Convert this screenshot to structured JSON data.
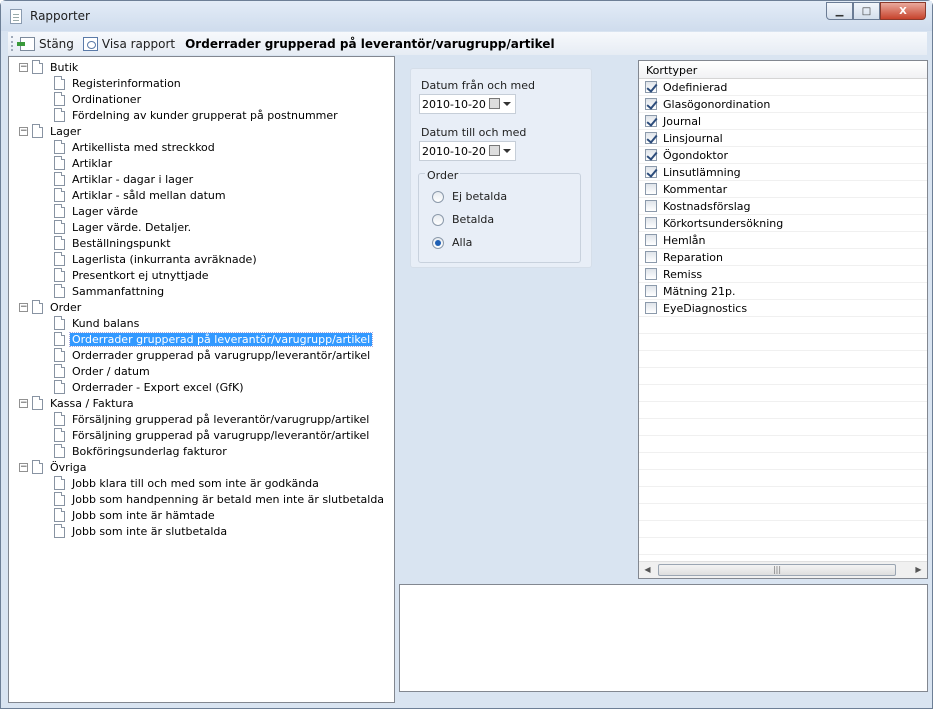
{
  "window": {
    "title": "Rapporter",
    "min_label": "▁",
    "max_label": "□",
    "close_label": "X"
  },
  "toolbar": {
    "close_label": "Stäng",
    "view_label": "Visa rapport",
    "report_title": "Orderrader grupperad på leverantör/varugrupp/artikel"
  },
  "tree": {
    "groups": [
      {
        "label": "Butik",
        "items": [
          "Registerinformation",
          "Ordinationer",
          "Fördelning av kunder grupperat på postnummer"
        ]
      },
      {
        "label": "Lager",
        "items": [
          "Artikellista med streckkod",
          "Artiklar",
          "Artiklar - dagar i lager",
          "Artiklar - såld mellan datum",
          "Lager värde",
          "Lager värde. Detaljer.",
          "Beställningspunkt",
          "Lagerlista (inkurranta avräknade)",
          "Presentkort ej utnyttjade",
          "Sammanfattning"
        ]
      },
      {
        "label": "Order",
        "items": [
          "Kund balans",
          "Orderrader grupperad på leverantör/varugrupp/artikel",
          "Orderrader grupperad på varugrupp/leverantör/artikel",
          "Order / datum",
          "Orderrader - Export excel (GfK)"
        ]
      },
      {
        "label": "Kassa / Faktura",
        "items": [
          "Försäljning grupperad på leverantör/varugrupp/artikel",
          "Försäljning grupperad på varugrupp/leverantör/artikel",
          "Bokföringsunderlag fakturor"
        ]
      },
      {
        "label": "Övriga",
        "items": [
          "Jobb klara till och med som inte är godkända",
          "Jobb som handpenning är betald men inte är slutbetalda",
          "Jobb som inte är hämtade",
          "Jobb som inte är slutbetalda"
        ]
      }
    ],
    "pm_symbol": "−"
  },
  "filters": {
    "from_label": "Datum från och med",
    "from_value": "2010-10-20",
    "to_label": "Datum till och med",
    "to_value": "2010-10-20",
    "order_label": "Order",
    "radios": [
      "Ej betalda",
      "Betalda",
      "Alla"
    ]
  },
  "cardtypes": {
    "header": "Korttyper",
    "items": [
      {
        "label": "Odefinierad",
        "checked": true
      },
      {
        "label": "Glasögonordination",
        "checked": true
      },
      {
        "label": "Journal",
        "checked": true
      },
      {
        "label": "Linsjournal",
        "checked": true
      },
      {
        "label": "Ögondoktor",
        "checked": true
      },
      {
        "label": "Linsutlämning",
        "checked": true
      },
      {
        "label": "Kommentar",
        "checked": false
      },
      {
        "label": "Kostnadsförslag",
        "checked": false
      },
      {
        "label": "Körkortsundersökning",
        "checked": false
      },
      {
        "label": "Hemlån",
        "checked": false
      },
      {
        "label": "Reparation",
        "checked": false
      },
      {
        "label": "Remiss",
        "checked": false
      },
      {
        "label": "Mätning 21p.",
        "checked": false
      },
      {
        "label": "EyeDiagnostics",
        "checked": false
      }
    ],
    "scroll_left": "◀",
    "scroll_right": "▶",
    "scroll_grip": "|||"
  }
}
